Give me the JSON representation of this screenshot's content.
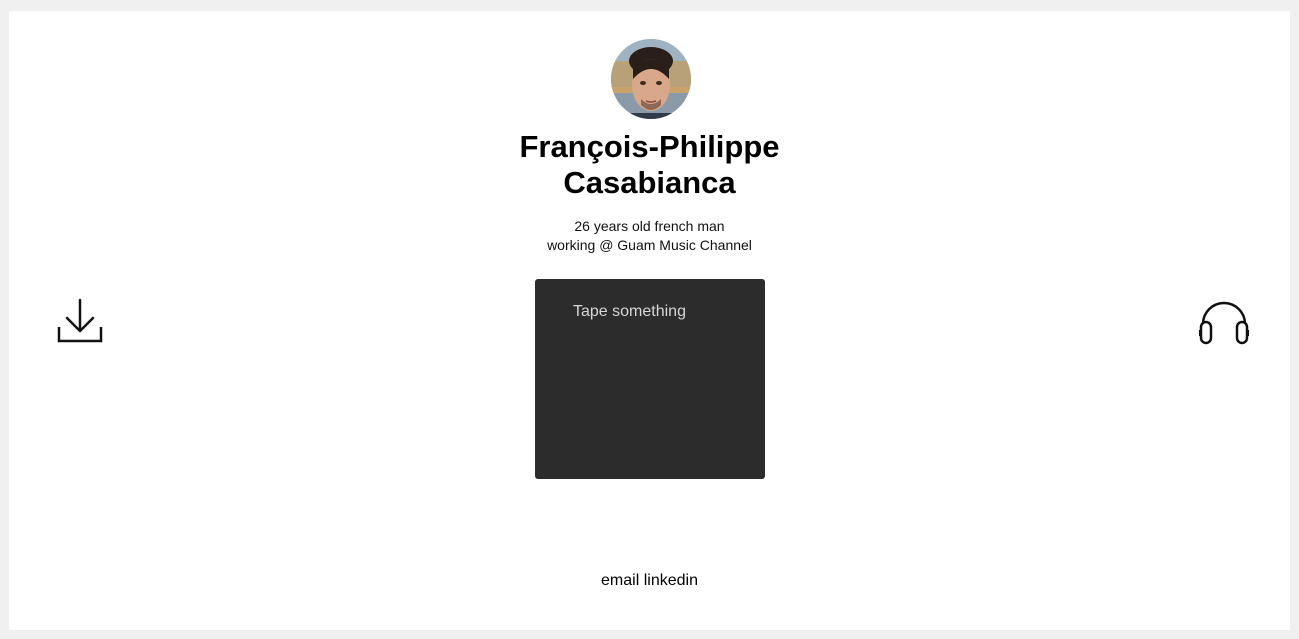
{
  "profile": {
    "name_line1": "François-Philippe",
    "name_line2": "Casabianca",
    "bio_line1": "26 years old french man",
    "bio_line2": "working @ Guam Music Channel"
  },
  "tape": {
    "placeholder": "Tape something",
    "value": ""
  },
  "actions": {
    "download_icon": "download-icon",
    "headphones_icon": "headphones-icon"
  },
  "footer": {
    "email_label": "email",
    "linkedin_label": "linkedin"
  },
  "colors": {
    "page_background": "#f0f0f0",
    "card_background": "#ffffff",
    "tape_background": "#2c2c2c"
  }
}
